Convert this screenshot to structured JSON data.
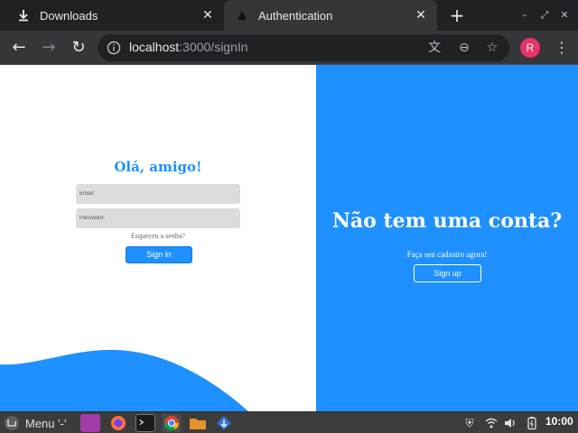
{
  "browser": {
    "tabs": [
      {
        "title": "Downloads",
        "icon": "download-icon"
      },
      {
        "title": "Authentication",
        "icon": "triangle-favicon-icon"
      }
    ],
    "address": {
      "host": "localhost",
      "path": ":3000/signIn"
    },
    "avatar_letter": "R"
  },
  "signin": {
    "title": "Olá, amigo!",
    "email_placeholder": "Email:",
    "password_placeholder": "Password:",
    "forgot_link": "Esqueceu a senha?",
    "submit_label": "Sign in"
  },
  "promo": {
    "title": "Não tem uma conta?",
    "text": "Faça seu cadastro agora!",
    "signup_label": "Sign up"
  },
  "taskbar": {
    "menu_label": "Menu '-'",
    "clock": "10:00"
  },
  "colors": {
    "accent": "#1e90ff",
    "avatar": "#e8336b"
  }
}
